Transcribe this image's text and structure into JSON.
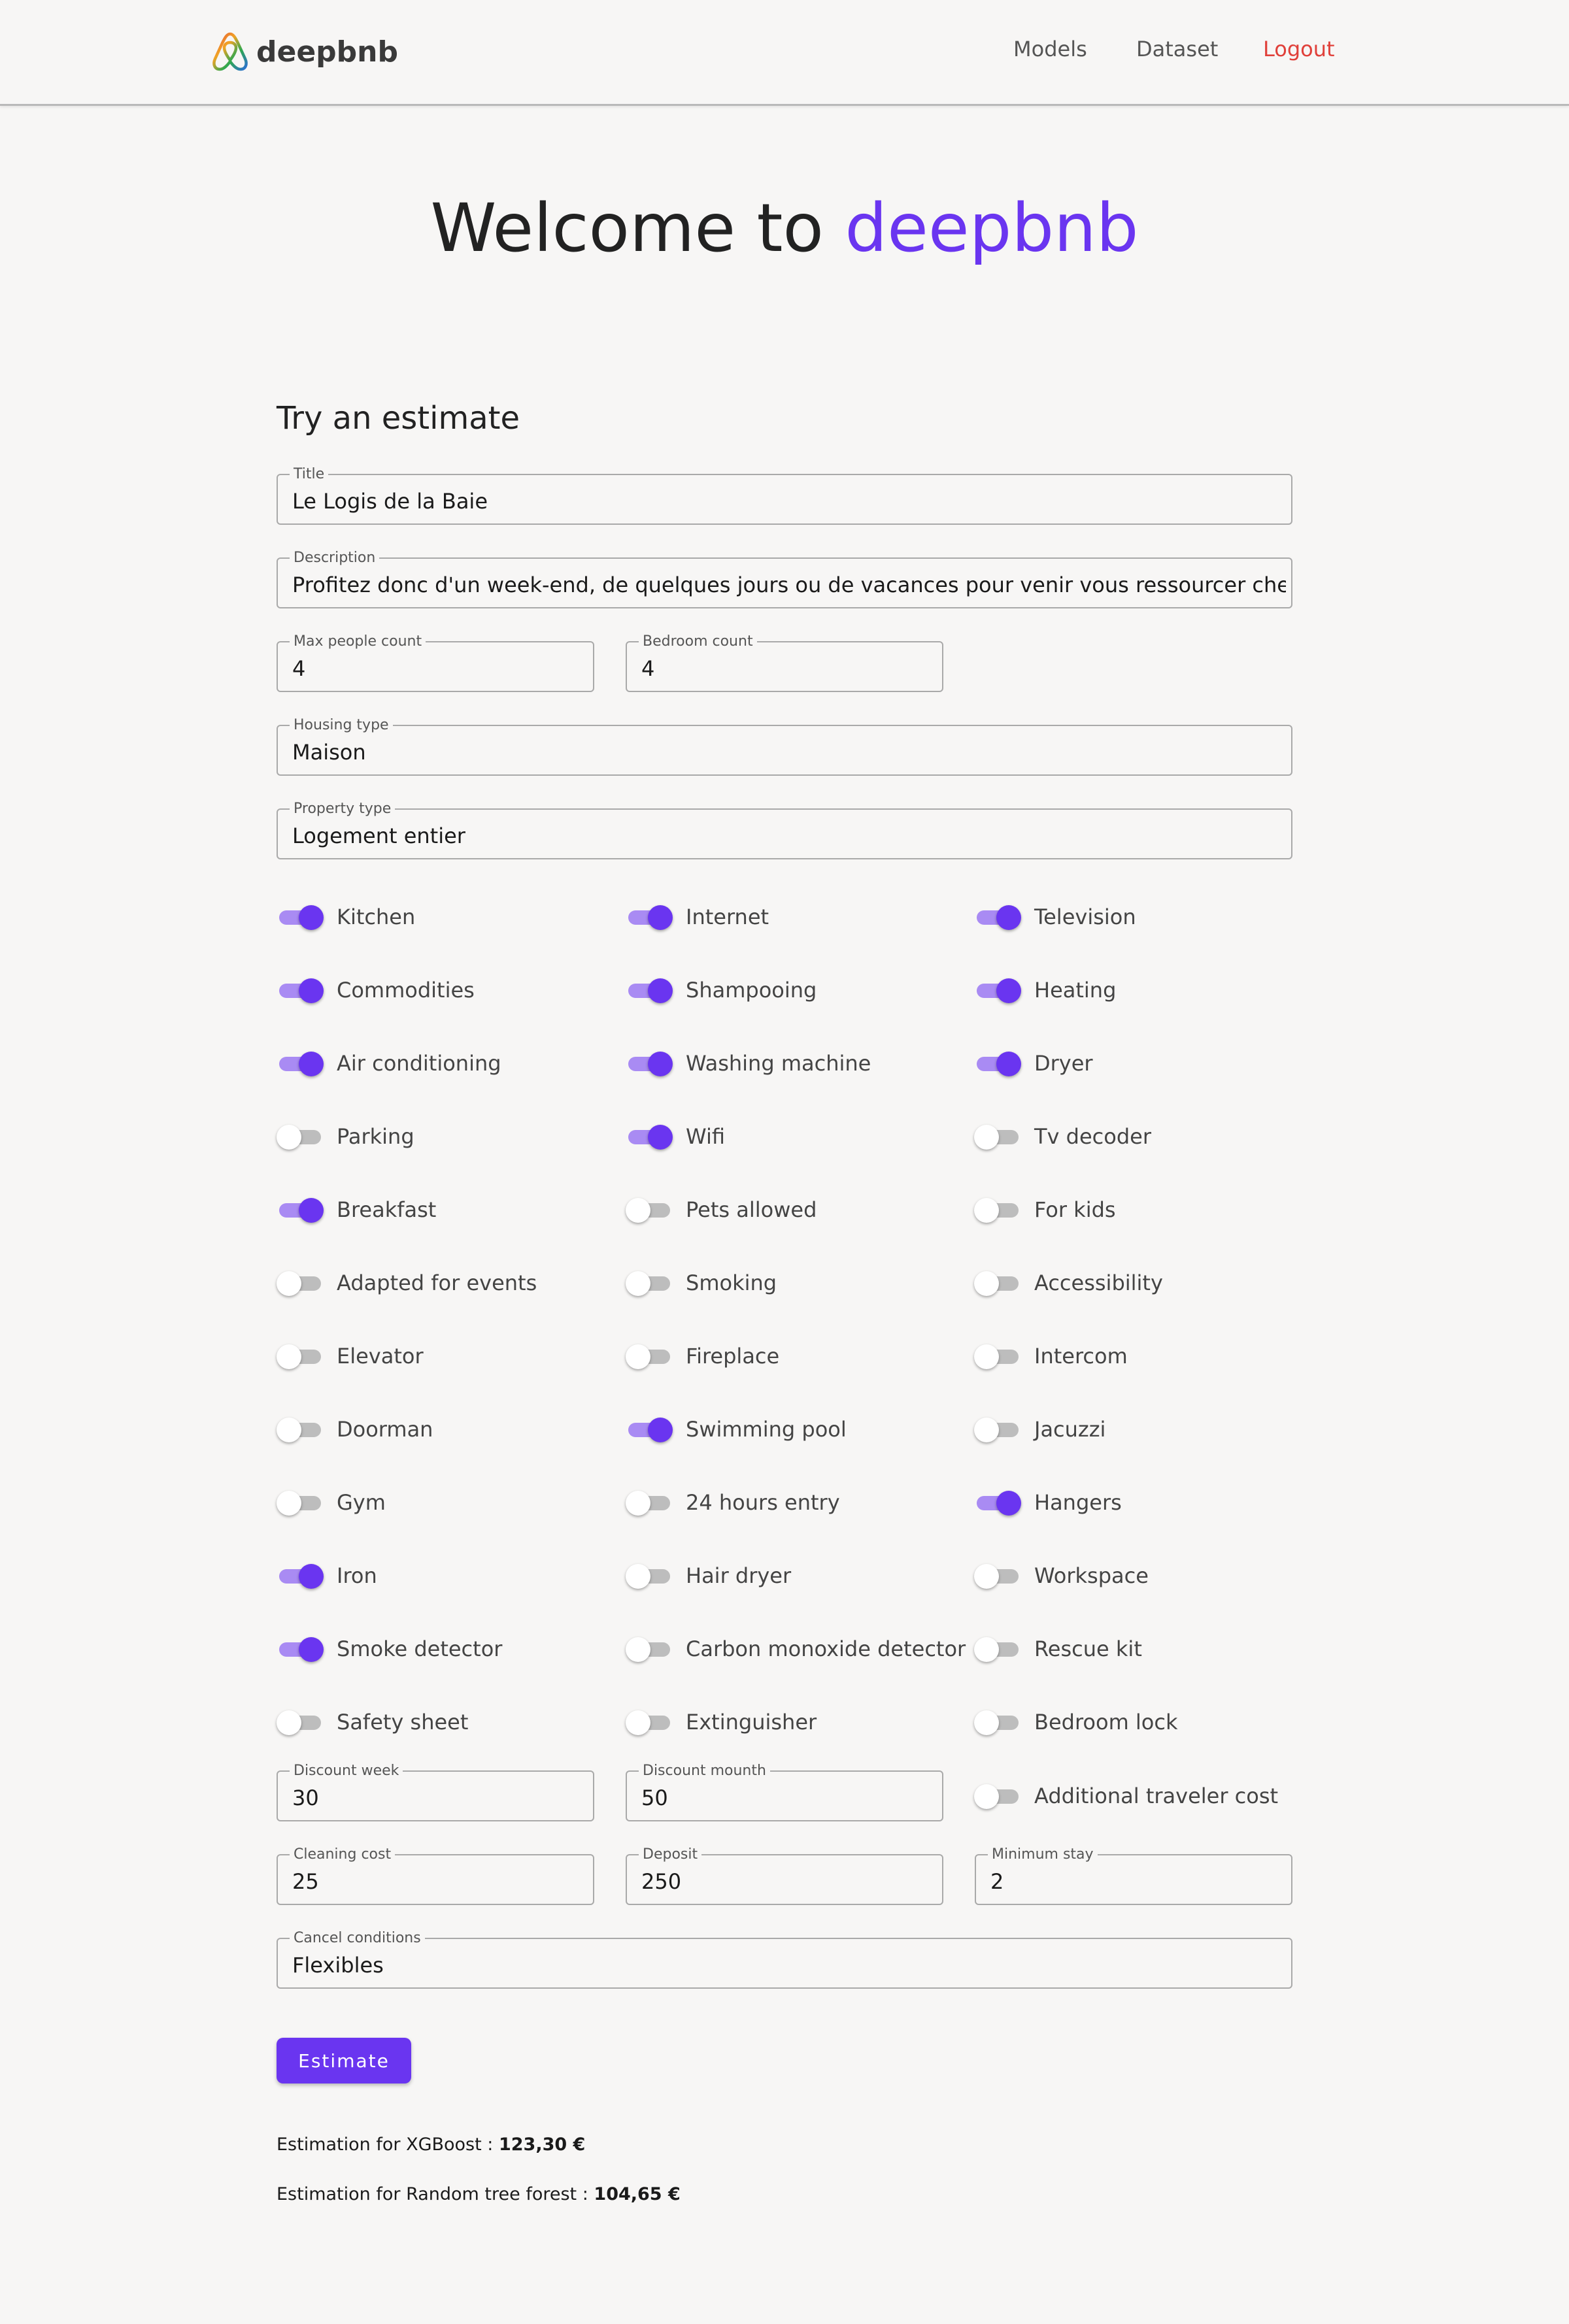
{
  "nav": {
    "brand": "deepbnb",
    "links": [
      {
        "label": "Models"
      },
      {
        "label": "Dataset"
      },
      {
        "label": "Logout"
      }
    ]
  },
  "hero": {
    "prefix": "Welcome to",
    "accent": "deepbnb"
  },
  "form": {
    "title": "Try an estimate",
    "fields": {
      "title": {
        "label": "Title",
        "value": "Le Logis de la Baie"
      },
      "description": {
        "label": "Description",
        "value": "Profitez donc d'un week-end, de quelques jours ou de vacances pour venir vous ressourcer chez nous"
      },
      "max_people": {
        "label": "Max people count",
        "value": "4"
      },
      "bedroom_count": {
        "label": "Bedroom count",
        "value": "4"
      },
      "housing_type": {
        "label": "Housing type",
        "value": "Maison"
      },
      "property_type": {
        "label": "Property type",
        "value": "Logement entier"
      },
      "discount_week": {
        "label": "Discount week",
        "value": "30"
      },
      "discount_month": {
        "label": "Discount mounth",
        "value": "50"
      },
      "cleaning_cost": {
        "label": "Cleaning cost",
        "value": "25"
      },
      "deposit": {
        "label": "Deposit",
        "value": "250"
      },
      "minimum_stay": {
        "label": "Minimum stay",
        "value": "2"
      },
      "cancel_conditions": {
        "label": "Cancel conditions",
        "value": "Flexibles"
      }
    },
    "amenities": [
      {
        "label": "Kitchen",
        "on": true
      },
      {
        "label": "Internet",
        "on": true
      },
      {
        "label": "Television",
        "on": true
      },
      {
        "label": "Commodities",
        "on": true
      },
      {
        "label": "Shampooing",
        "on": true
      },
      {
        "label": "Heating",
        "on": true
      },
      {
        "label": "Air conditioning",
        "on": true
      },
      {
        "label": "Washing machine",
        "on": true
      },
      {
        "label": "Dryer",
        "on": true
      },
      {
        "label": "Parking",
        "on": false
      },
      {
        "label": "Wifi",
        "on": true
      },
      {
        "label": "Tv decoder",
        "on": false
      },
      {
        "label": "Breakfast",
        "on": true
      },
      {
        "label": "Pets allowed",
        "on": false
      },
      {
        "label": "For kids",
        "on": false
      },
      {
        "label": "Adapted for events",
        "on": false
      },
      {
        "label": "Smoking",
        "on": false
      },
      {
        "label": "Accessibility",
        "on": false
      },
      {
        "label": "Elevator",
        "on": false
      },
      {
        "label": "Fireplace",
        "on": false
      },
      {
        "label": "Intercom",
        "on": false
      },
      {
        "label": "Doorman",
        "on": false
      },
      {
        "label": "Swimming pool",
        "on": true
      },
      {
        "label": "Jacuzzi",
        "on": false
      },
      {
        "label": "Gym",
        "on": false
      },
      {
        "label": "24 hours entry",
        "on": false
      },
      {
        "label": "Hangers",
        "on": true
      },
      {
        "label": "Iron",
        "on": true
      },
      {
        "label": "Hair dryer",
        "on": false
      },
      {
        "label": "Workspace",
        "on": false
      },
      {
        "label": "Smoke detector",
        "on": true
      },
      {
        "label": "Carbon monoxide detector",
        "on": false
      },
      {
        "label": "Rescue kit",
        "on": false
      },
      {
        "label": "Safety sheet",
        "on": false
      },
      {
        "label": "Extinguisher",
        "on": false
      },
      {
        "label": "Bedroom lock",
        "on": false
      }
    ],
    "additional_traveler_cost": {
      "label": "Additional traveler cost",
      "on": false
    },
    "estimate_button": "Estimate"
  },
  "results": [
    {
      "label": "Estimation for XGBoost : ",
      "value": "123,30 €"
    },
    {
      "label": "Estimation for Random tree forest : ",
      "value": "104,65 €"
    }
  ],
  "colors": {
    "accent": "#6a35f0",
    "logout": "#e0403a",
    "background": "#f7f6f5"
  }
}
